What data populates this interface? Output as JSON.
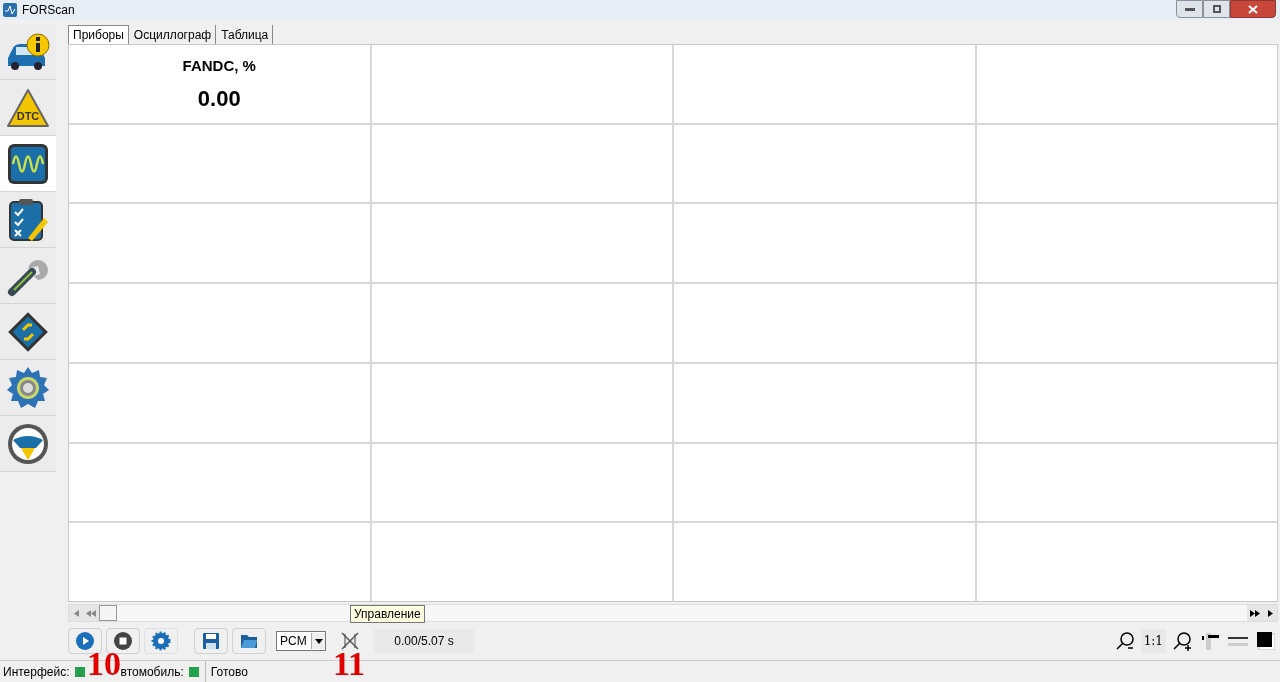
{
  "window": {
    "title": "FORScan"
  },
  "sidebar": {
    "items": [
      {
        "kind": "info",
        "selected": false
      },
      {
        "kind": "dtc",
        "label": "DTC",
        "selected": false
      },
      {
        "kind": "scope",
        "selected": true
      },
      {
        "kind": "tests",
        "selected": false
      },
      {
        "kind": "service",
        "selected": false
      },
      {
        "kind": "modules",
        "selected": false
      },
      {
        "kind": "settings",
        "selected": false
      },
      {
        "kind": "help",
        "selected": false
      }
    ]
  },
  "tabs": [
    {
      "label": "Приборы",
      "selected": true
    },
    {
      "label": "Осциллограф",
      "selected": false
    },
    {
      "label": "Таблица",
      "selected": false
    }
  ],
  "gauges": [
    {
      "title": "FANDC, %",
      "value": "0.00"
    }
  ],
  "toolbar": {
    "module": "PCM",
    "time": "0.00/5.07 s",
    "zoom_reset": "1:1",
    "tooltip": "Управление"
  },
  "status_bar": {
    "items": [
      {
        "label": "Интерфейс:",
        "color": "#22a04b"
      },
      {
        "label": "втомобиль:",
        "color": "#22a04b"
      }
    ],
    "message": "Готово"
  },
  "annotations": [
    "10",
    "11"
  ]
}
